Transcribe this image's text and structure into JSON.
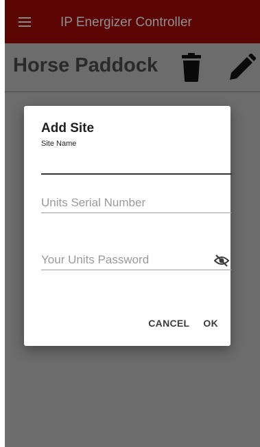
{
  "appbar": {
    "title": "IP Energizer Controller",
    "menu_icon": "hamburger-menu-icon",
    "color": "#5c0505"
  },
  "site": {
    "name": "Horse Paddock",
    "delete_icon": "trash-icon",
    "edit_icon": "pencil-icon"
  },
  "dialog": {
    "title": "Add Site",
    "site_name_caption": "Site Name",
    "site_name_value": "",
    "serial_placeholder": "Units Serial Number",
    "serial_value": "",
    "password_placeholder": "Your Units Password",
    "password_value": "",
    "visibility_icon": "eye-off-icon",
    "cancel_label": "CANCEL",
    "ok_label": "OK"
  },
  "colors": {
    "overlay": "#6c6c6c",
    "dialog_bg": "#ffffff"
  }
}
